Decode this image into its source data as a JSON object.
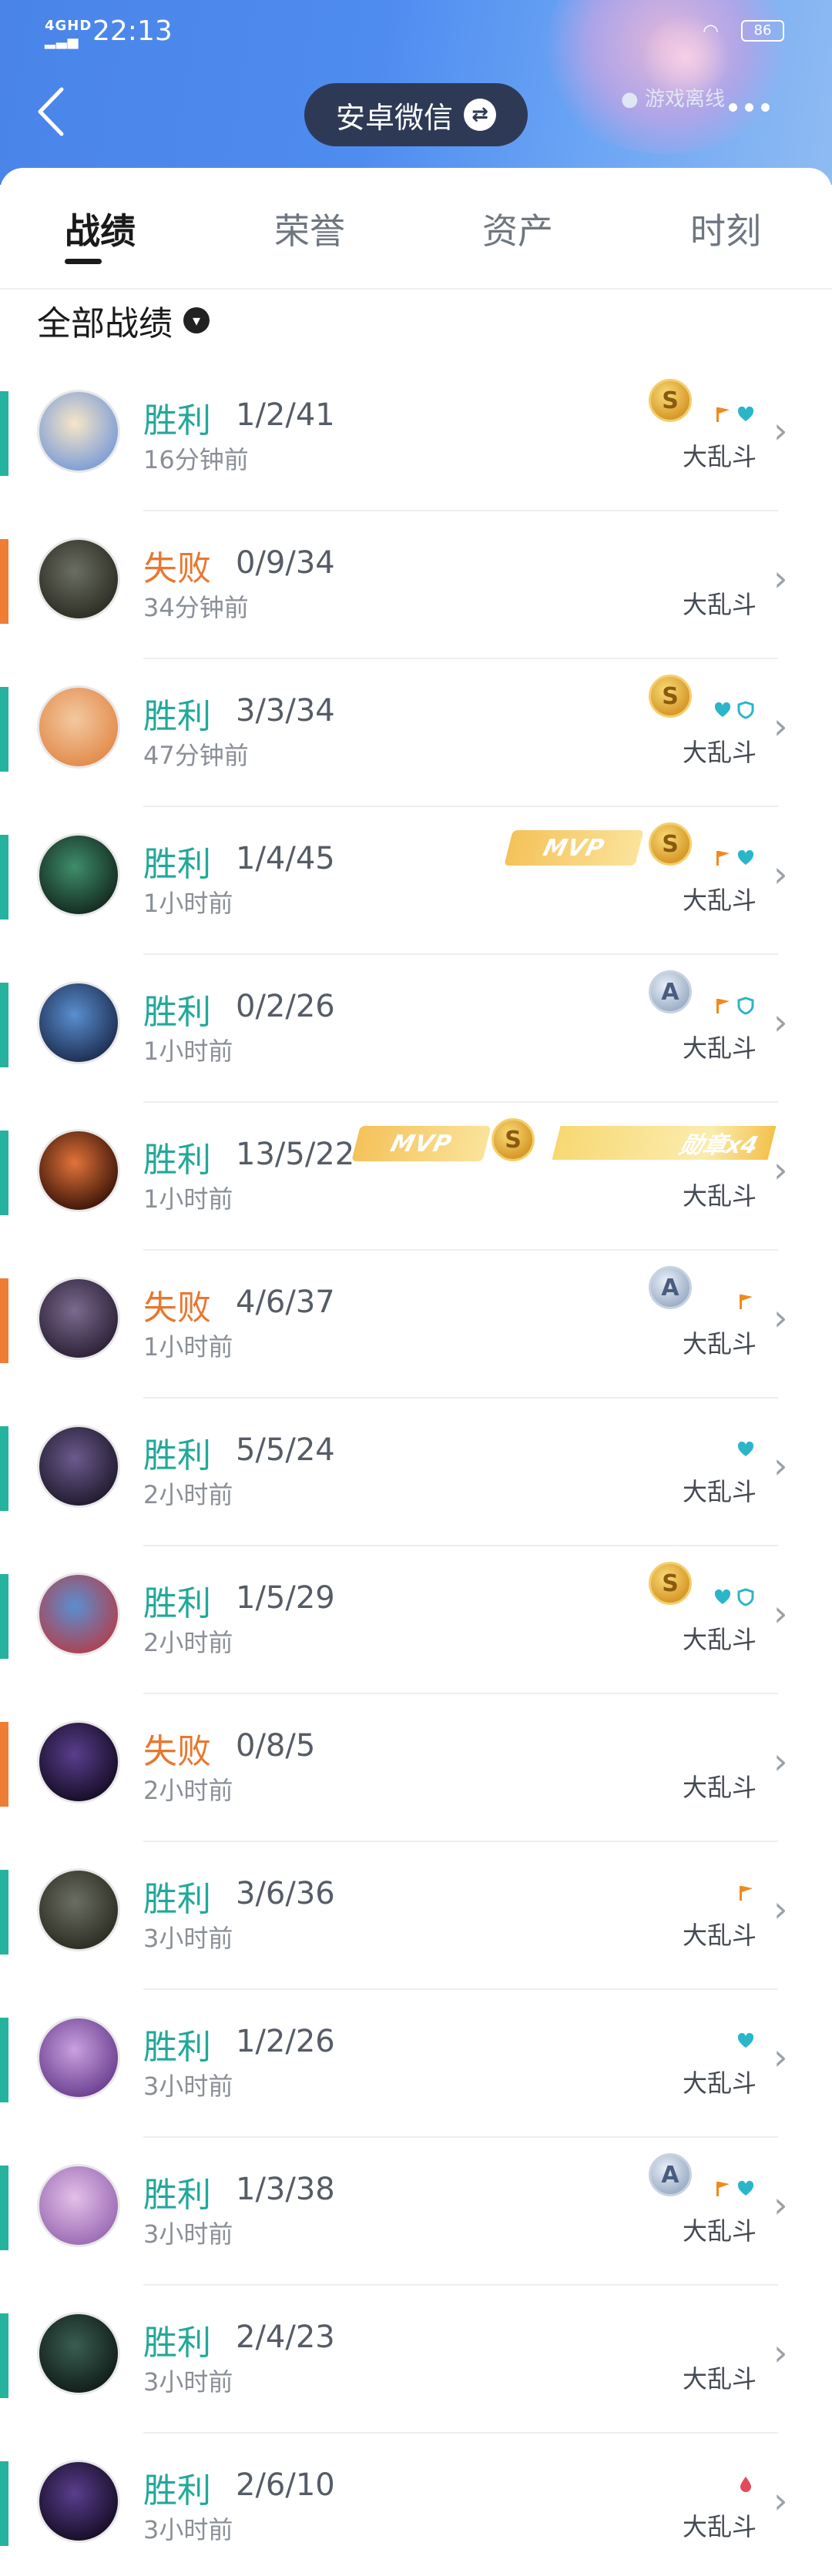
{
  "status_bar": {
    "signal": "4GHD",
    "time": "22:13",
    "battery": "86"
  },
  "header": {
    "account_label": "安卓微信",
    "offline_label": "游戏离线"
  },
  "tabs": [
    {
      "label": "战绩",
      "active": true
    },
    {
      "label": "荣誉",
      "active": false
    },
    {
      "label": "资产",
      "active": false
    },
    {
      "label": "时刻",
      "active": false
    }
  ],
  "filter": {
    "label": "全部战绩"
  },
  "mvp_label": "MVP",
  "s_label": "S",
  "a_label": "A",
  "colors": {
    "win": "#25b3a0",
    "loss": "#ef7d34",
    "header": "#4f8cf0",
    "gold": "#f0c050"
  },
  "matches": [
    {
      "result": "胜利",
      "outcome": "win",
      "kda": "1/2/41",
      "ago": "16分钟前",
      "mode": "大乱斗",
      "rating": "S",
      "mvp": false,
      "medal": "",
      "icons": [
        "flag",
        "heart"
      ],
      "avatar": [
        "#f7e6c8",
        "#7a9cd6"
      ]
    },
    {
      "result": "失败",
      "outcome": "loss",
      "kda": "0/9/34",
      "ago": "34分钟前",
      "mode": "大乱斗",
      "rating": "",
      "mvp": false,
      "medal": "",
      "icons": [],
      "avatar": [
        "#6b6f62",
        "#2b2b22"
      ]
    },
    {
      "result": "胜利",
      "outcome": "win",
      "kda": "3/3/34",
      "ago": "47分钟前",
      "mode": "大乱斗",
      "rating": "S",
      "mvp": false,
      "medal": "",
      "icons": [
        "heart",
        "shield"
      ],
      "avatar": [
        "#f3c9a0",
        "#e28a4a"
      ]
    },
    {
      "result": "胜利",
      "outcome": "win",
      "kda": "1/4/45",
      "ago": "1小时前",
      "mode": "大乱斗",
      "rating": "S",
      "mvp": true,
      "medal": "",
      "icons": [
        "flag",
        "heart"
      ],
      "avatar": [
        "#3e8e6a",
        "#14281f"
      ]
    },
    {
      "result": "胜利",
      "outcome": "win",
      "kda": "0/2/26",
      "ago": "1小时前",
      "mode": "大乱斗",
      "rating": "A",
      "mvp": false,
      "medal": "",
      "icons": [
        "flag",
        "shield"
      ],
      "avatar": [
        "#5a8fd0",
        "#1c2c4f"
      ]
    },
    {
      "result": "胜利",
      "outcome": "win",
      "kda": "13/5/22",
      "ago": "1小时前",
      "mode": "大乱斗",
      "rating": "S",
      "mvp": true,
      "medal": "勋章x4",
      "icons": [],
      "avatar": [
        "#e2733a",
        "#3a1408"
      ]
    },
    {
      "result": "失败",
      "outcome": "loss",
      "kda": "4/6/37",
      "ago": "1小时前",
      "mode": "大乱斗",
      "rating": "A",
      "mvp": false,
      "medal": "",
      "icons": [
        "flag"
      ],
      "avatar": [
        "#7c6a8e",
        "#2a2036"
      ]
    },
    {
      "result": "胜利",
      "outcome": "win",
      "kda": "5/5/24",
      "ago": "2小时前",
      "mode": "大乱斗",
      "rating": "",
      "mvp": false,
      "medal": "",
      "icons": [
        "heart"
      ],
      "avatar": [
        "#6b5a8e",
        "#1f1a2c"
      ]
    },
    {
      "result": "胜利",
      "outcome": "win",
      "kda": "1/5/29",
      "ago": "2小时前",
      "mode": "大乱斗",
      "rating": "S",
      "mvp": false,
      "medal": "",
      "icons": [
        "heart",
        "shield"
      ],
      "avatar": [
        "#5a8fd0",
        "#b04050"
      ]
    },
    {
      "result": "失败",
      "outcome": "loss",
      "kda": "0/8/5",
      "ago": "2小时前",
      "mode": "大乱斗",
      "rating": "",
      "mvp": false,
      "medal": "",
      "icons": [],
      "avatar": [
        "#5a3e8e",
        "#150c24"
      ]
    },
    {
      "result": "胜利",
      "outcome": "win",
      "kda": "3/6/36",
      "ago": "3小时前",
      "mode": "大乱斗",
      "rating": "",
      "mvp": false,
      "medal": "",
      "icons": [
        "flag"
      ],
      "avatar": [
        "#6b6f62",
        "#2b2b22"
      ]
    },
    {
      "result": "胜利",
      "outcome": "win",
      "kda": "1/2/26",
      "ago": "3小时前",
      "mode": "大乱斗",
      "rating": "",
      "mvp": false,
      "medal": "",
      "icons": [
        "heart"
      ],
      "avatar": [
        "#c9a0e0",
        "#6a3e8e"
      ]
    },
    {
      "result": "胜利",
      "outcome": "win",
      "kda": "1/3/38",
      "ago": "3小时前",
      "mode": "大乱斗",
      "rating": "A",
      "mvp": false,
      "medal": "",
      "icons": [
        "flag",
        "heart"
      ],
      "avatar": [
        "#e3c0e8",
        "#9a6ab4"
      ]
    },
    {
      "result": "胜利",
      "outcome": "win",
      "kda": "2/4/23",
      "ago": "3小时前",
      "mode": "大乱斗",
      "rating": "",
      "mvp": false,
      "medal": "",
      "icons": [],
      "avatar": [
        "#3a5e52",
        "#101c18"
      ]
    },
    {
      "result": "胜利",
      "outcome": "win",
      "kda": "2/6/10",
      "ago": "3小时前",
      "mode": "大乱斗",
      "rating": "",
      "mvp": false,
      "medal": "",
      "icons": [
        "drop"
      ],
      "avatar": [
        "#5a3e8e",
        "#150c24"
      ]
    }
  ]
}
